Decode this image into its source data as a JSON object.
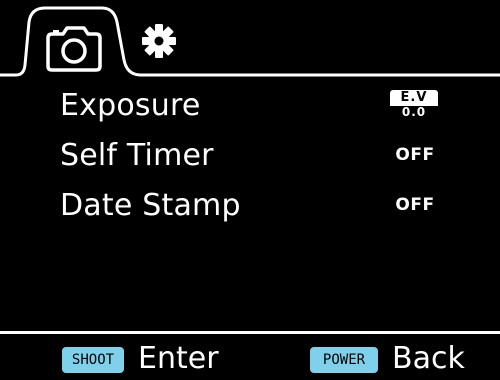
{
  "tabs": [
    {
      "icon": "camera-icon",
      "active": true
    },
    {
      "icon": "gear-icon",
      "active": false
    }
  ],
  "menu": {
    "items": [
      {
        "label": "Exposure",
        "value_top": "E.V",
        "value_bottom": "0.0"
      },
      {
        "label": "Self Timer",
        "value": "OFF"
      },
      {
        "label": "Date Stamp",
        "value": "OFF"
      }
    ]
  },
  "footer": {
    "shoot_key": "SHOOT",
    "shoot_action": "Enter",
    "power_key": "POWER",
    "power_action": "Back"
  },
  "colors": {
    "background": "#000000",
    "foreground": "#ffffff",
    "key_badge": "#7fd0ea"
  }
}
